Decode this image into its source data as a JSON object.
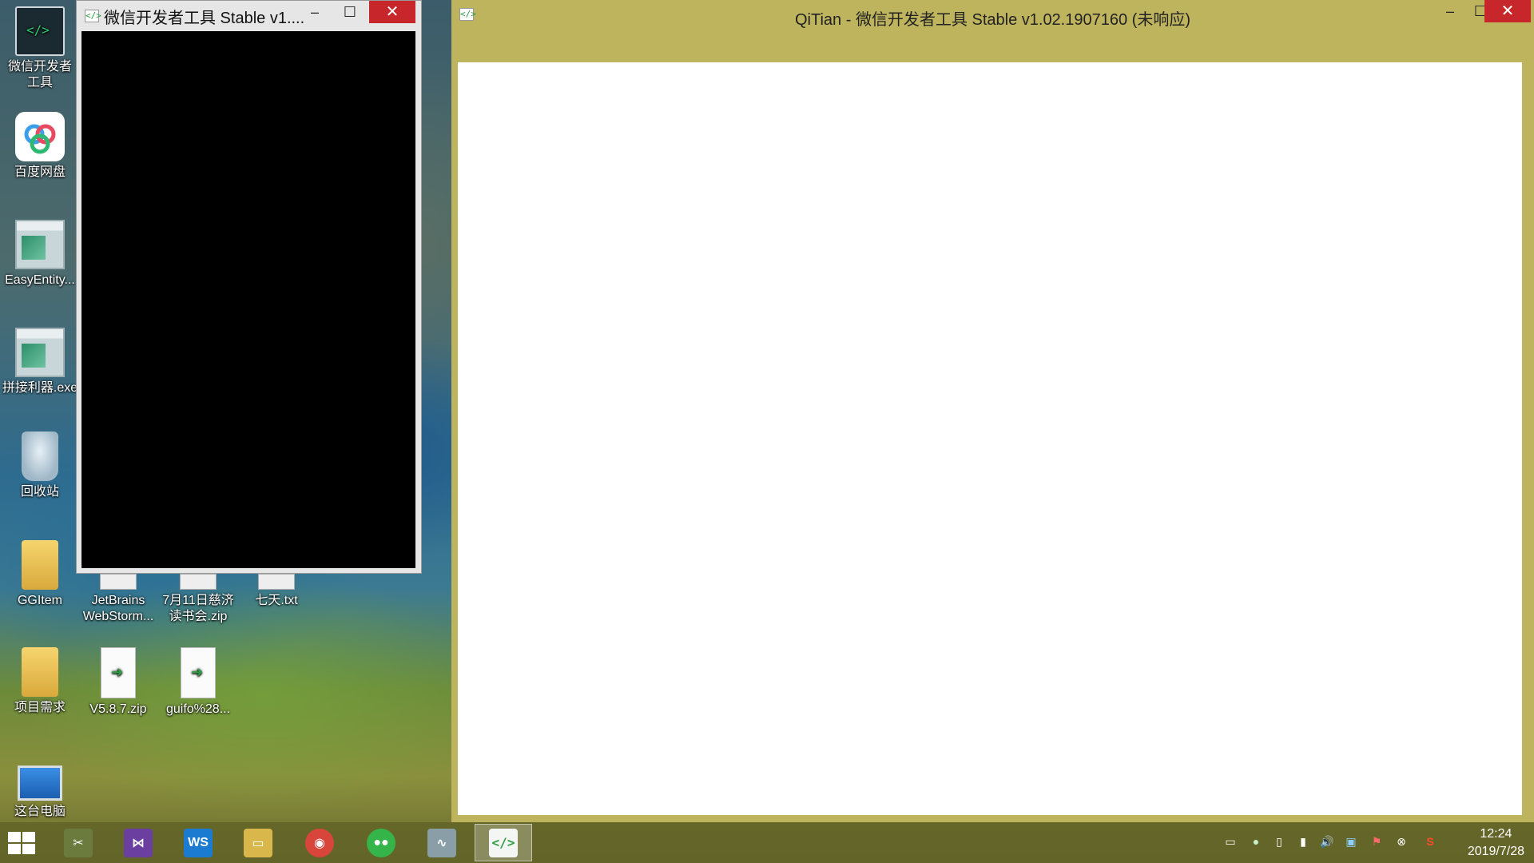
{
  "desktop": {
    "icons": [
      {
        "label": "微信开发者\n工具"
      },
      {
        "label": "百度网盘"
      },
      {
        "label": "EasyEntity..."
      },
      {
        "label": "拼接利器.exe"
      },
      {
        "label": "回收站"
      },
      {
        "label": "GGItem"
      },
      {
        "label": "JetBrains\nWebStorm..."
      },
      {
        "label": "7月11日慈济\n读书会.zip"
      },
      {
        "label": "七天.txt"
      },
      {
        "label": "项目需求"
      },
      {
        "label": "V5.8.7.zip"
      },
      {
        "label": "guifo%28..."
      },
      {
        "label": "这台电脑"
      }
    ]
  },
  "small_window": {
    "title": "微信开发者工具 Stable v1...."
  },
  "main_window": {
    "title": "QiTian - 微信开发者工具 Stable v1.02.1907160 (未响应)"
  },
  "window_buttons": {
    "minimize": "–",
    "maximize": "☐",
    "close": "✕"
  },
  "app_icon_glyph": "</>",
  "taskbar": {
    "apps": [
      {
        "name": "tools-icon",
        "glyph": "✂",
        "color": "#6b7a3d"
      },
      {
        "name": "visual-studio-icon",
        "glyph": "⋈",
        "color": "#6a3fa0"
      },
      {
        "name": "webstorm-icon",
        "glyph": "WS",
        "color": "#1a7bd0"
      },
      {
        "name": "file-explorer-icon",
        "glyph": "▭",
        "color": "#d9b74b"
      },
      {
        "name": "chrome-icon",
        "glyph": "◉",
        "color": "#d8453b"
      },
      {
        "name": "wechat-icon",
        "glyph": "●●",
        "color": "#35b44a"
      },
      {
        "name": "monitor-icon",
        "glyph": "∿",
        "color": "#8a9ea8"
      },
      {
        "name": "wechat-devtools-icon",
        "glyph": "</>",
        "color": "#2e9c44"
      }
    ],
    "tray": [
      "▭",
      "●",
      "▯",
      "▮",
      "🔊",
      "▣",
      "⚑",
      "⊗",
      "S"
    ]
  },
  "clock": {
    "time": "12:24",
    "date": "2019/7/28"
  }
}
